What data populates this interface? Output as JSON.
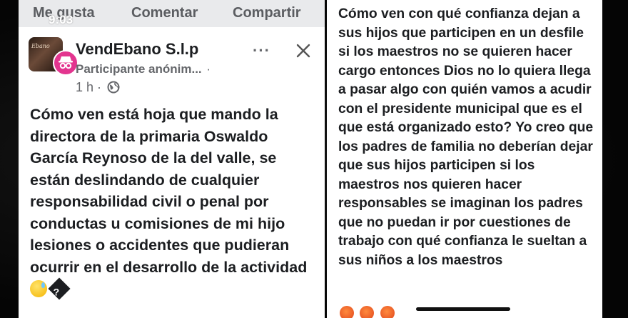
{
  "left_post": {
    "actions": {
      "like": "Me gusta",
      "comment": "Comentar",
      "share": "Compartir"
    },
    "status_time": "9:03",
    "page_name": "VendEbano S.l.p",
    "author_label": "Participante anónim...",
    "author_suffix": "·",
    "timestamp": "1 h ·",
    "more_icon": "···",
    "post_text": "Cómo ven está hoja que mando la directora de la primaria Oswaldo García Reynoso de la del valle, se están deslindando de cualquier responsabilidad civil o penal por conductas u comisiones de mi hijo lesiones o accidentes que pudieran ocurrir en el desarrollo de la actividad",
    "unknown_glyph": "?",
    "colors": {
      "anon_badge": "#e3358f",
      "text": "#1c1e21",
      "meta": "#65676b"
    }
  },
  "right_comment": {
    "text": "Cómo ven con qué confianza dejan a sus hijos que participen en un desfile si los maestros no se quieren hacer cargo entonces Dios no lo quiera llega a pasar algo con quién vamos a acudir con el presidente municipal que es el que está organizado esto?  Yo creo que los padres de familia no deberían dejar que sus hijos participen si  los maestros nos quieren hacer responsables se imaginan los padres que no puedan ir por cuestiones de trabajo con qué confianza le sueltan a sus niños a los maestros",
    "reaction_icons": [
      "angry-face-icon",
      "angry-face-icon",
      "angry-face-icon"
    ]
  }
}
